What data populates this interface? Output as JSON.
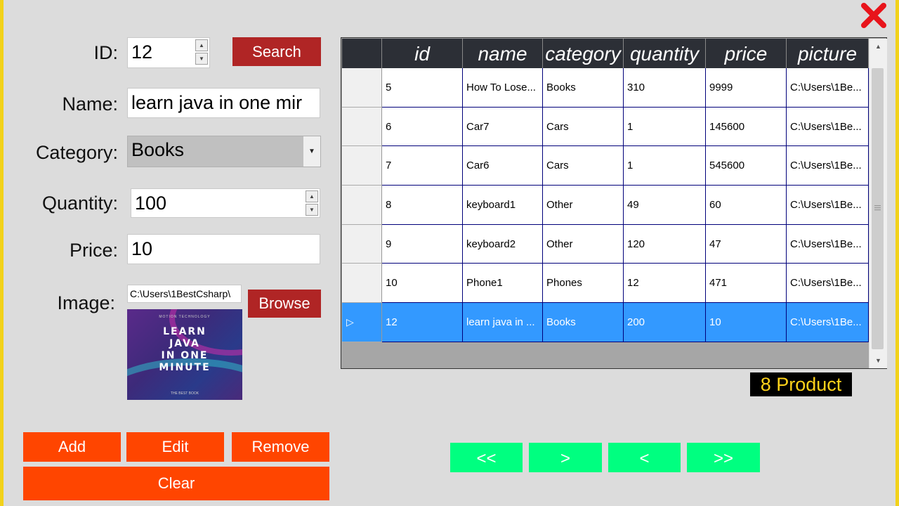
{
  "window": {
    "close_icon": "close-x-icon",
    "accent_color": "#f2d21b"
  },
  "form": {
    "id_label": "ID:",
    "id_value": "12",
    "search_button": "Search",
    "name_label": "Name:",
    "name_value": "learn java in one mir",
    "category_label": "Category:",
    "category_value": "Books",
    "quantity_label": "Quantity:",
    "quantity_value": "100",
    "price_label": "Price:",
    "price_value": "10",
    "image_label": "Image:",
    "image_path": "C:\\Users\\1BestCsharp\\",
    "browse_button": "Browse",
    "image_preview": {
      "top_text": "MOTION TECHNOLOGY",
      "title_lines": [
        "LEARN",
        "JAVA",
        "IN ONE",
        "MINUTE"
      ],
      "bottom_text": "THE BEST BOOK"
    }
  },
  "actions": {
    "add": "Add",
    "edit": "Edit",
    "remove": "Remove",
    "clear": "Clear"
  },
  "grid": {
    "columns": [
      "id",
      "name",
      "category",
      "quantity",
      "price",
      "picture"
    ],
    "rows": [
      {
        "id": "5",
        "name": "How To Lose...",
        "category": "Books",
        "quantity": "310",
        "price": "9999",
        "picture": "C:\\Users\\1Be..."
      },
      {
        "id": "6",
        "name": "Car7",
        "category": "Cars",
        "quantity": "1",
        "price": "145600",
        "picture": "C:\\Users\\1Be..."
      },
      {
        "id": "7",
        "name": "Car6",
        "category": "Cars",
        "quantity": "1",
        "price": "545600",
        "picture": "C:\\Users\\1Be..."
      },
      {
        "id": "8",
        "name": "keyboard1",
        "category": "Other",
        "quantity": "49",
        "price": "60",
        "picture": "C:\\Users\\1Be..."
      },
      {
        "id": "9",
        "name": "keyboard2",
        "category": "Other",
        "quantity": "120",
        "price": "47",
        "picture": "C:\\Users\\1Be..."
      },
      {
        "id": "10",
        "name": "Phone1",
        "category": "Phones",
        "quantity": "12",
        "price": "471",
        "picture": "C:\\Users\\1Be..."
      },
      {
        "id": "12",
        "name": "learn java in ...",
        "category": "Books",
        "quantity": "200",
        "price": "10",
        "picture": "C:\\Users\\1Be..."
      }
    ],
    "selected_row_index": 6
  },
  "product_count": "8 Product",
  "navigation": {
    "first": "<<",
    "next": ">",
    "previous": "<",
    "last": ">>"
  }
}
